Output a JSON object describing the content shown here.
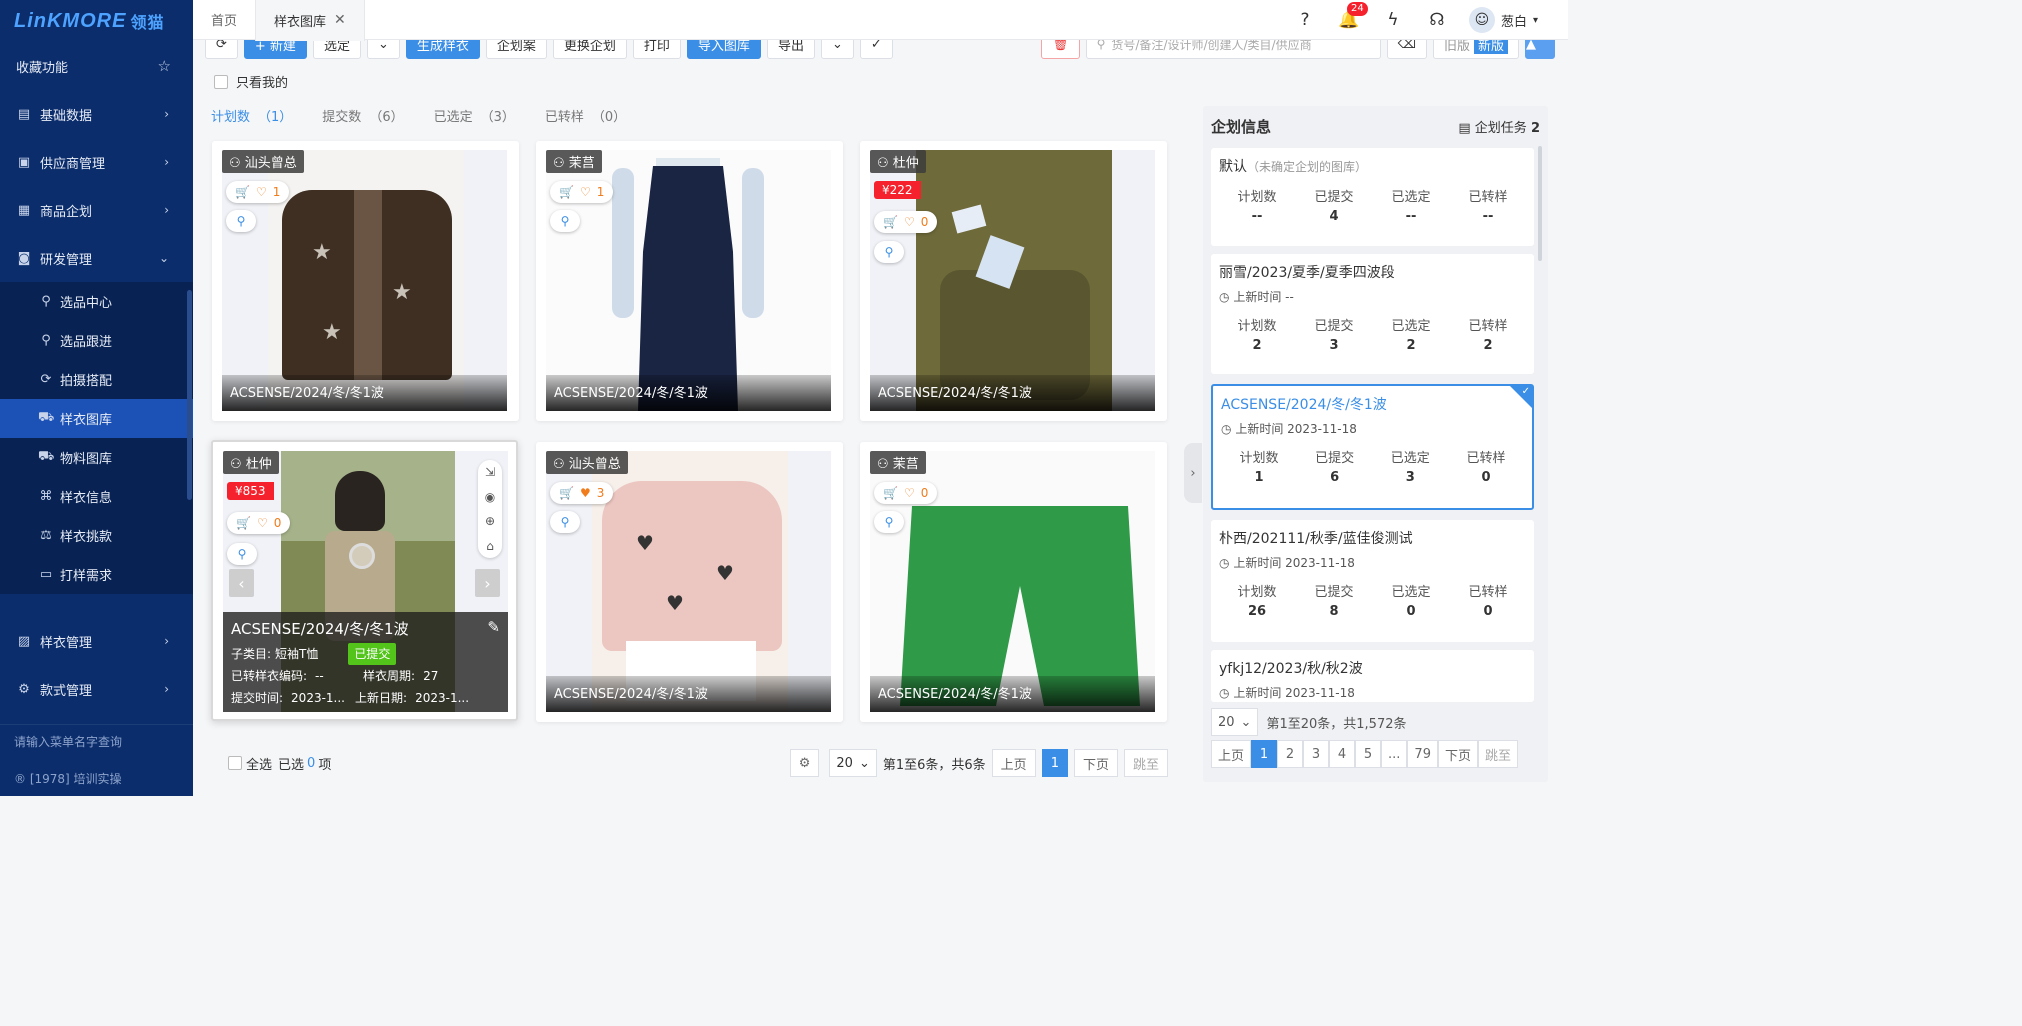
{
  "app": {
    "logo": "LinKMORE",
    "logo_cn": "领猫"
  },
  "sidebar": {
    "favorites": "收藏功能",
    "items": [
      {
        "label": "基础数据"
      },
      {
        "label": "供应商管理"
      },
      {
        "label": "商品企划"
      },
      {
        "label": "研发管理"
      }
    ],
    "sub_items": [
      {
        "label": "选品中心"
      },
      {
        "label": "选品跟进"
      },
      {
        "label": "拍摄搭配"
      },
      {
        "label": "样衣图库"
      },
      {
        "label": "物料图库"
      },
      {
        "label": "样衣信息"
      },
      {
        "label": "样衣挑款"
      },
      {
        "label": "打样需求"
      }
    ],
    "items2": [
      {
        "label": "样衣管理"
      },
      {
        "label": "款式管理"
      }
    ],
    "search_placeholder": "请输入菜单名字查询",
    "footer": "® [1978] 培训实操"
  },
  "tabs": [
    {
      "label": "首页"
    },
    {
      "label": "样衣图库"
    }
  ],
  "topbar": {
    "notif_count": "24",
    "user_name": "葱白"
  },
  "toolbar": {
    "new": "+ 新建",
    "select": "选定",
    "generate": "生成样衣",
    "plan": "企划案",
    "change_plan": "更换企划",
    "print": "打印",
    "import": "导入图库",
    "export": "导出",
    "search_placeholder": "货号/备注/设计师/创建人/类目/供应商",
    "old": "旧版",
    "new_ver": "新版"
  },
  "only_mine": "只看我的",
  "stat_tabs": [
    {
      "label": "计划数",
      "count": "（1）"
    },
    {
      "label": "提交数",
      "count": "（6）"
    },
    {
      "label": "已选定",
      "count": "（3）"
    },
    {
      "label": "已转样",
      "count": "（0）"
    }
  ],
  "cards": [
    {
      "owner": "汕头曾总",
      "fav": "1",
      "caption": "ACSENSE/2024/冬/冬1波"
    },
    {
      "owner": "茉莒",
      "fav": "1",
      "caption": "ACSENSE/2024/冬/冬1波"
    },
    {
      "owner": "杜仲",
      "price": "¥222",
      "fav": "0",
      "caption": "ACSENSE/2024/冬/冬1波"
    },
    {
      "owner": "杜仲",
      "price": "¥853",
      "fav": "0",
      "caption": "ACSENSE/2024/冬/冬1波",
      "subcat_label": "子类目:",
      "subcat": "短袖T恤",
      "status": "已提交",
      "code_label": "已转样衣编码:",
      "code": "--",
      "cycle_label": "样衣周期:",
      "cycle": "27",
      "submit_label": "提交时间:",
      "submit": "2023-1...",
      "newdate_label": "上新日期:",
      "newdate": "2023-1..."
    },
    {
      "owner": "汕头曾总",
      "fav": "3",
      "caption": "ACSENSE/2024/冬/冬1波"
    },
    {
      "owner": "茉莒",
      "fav": "0",
      "caption": "ACSENSE/2024/冬/冬1波"
    }
  ],
  "footer": {
    "select_all": "全选",
    "selected_prefix": "已选",
    "selected_count": "0",
    "selected_suffix": "项",
    "page_size": "20",
    "range": "第1至6条，共6条",
    "prev": "上页",
    "page": "1",
    "next": "下页",
    "jump": "跳至"
  },
  "panel": {
    "title": "企划信息",
    "task_label": "企划任务",
    "task_count": "2",
    "stat_labels": [
      "计划数",
      "已提交",
      "已选定",
      "已转样"
    ],
    "cards": [
      {
        "name": "默认",
        "sub": "（未确定企划的图库）",
        "values": [
          "--",
          "4",
          "--",
          "--"
        ]
      },
      {
        "name": "丽雪/2023/夏季/夏季四波段",
        "time": "上新时间 --",
        "values": [
          "2",
          "3",
          "2",
          "2"
        ]
      },
      {
        "name": "ACSENSE/2024/冬/冬1波",
        "time": "上新时间 2023-11-18",
        "values": [
          "1",
          "6",
          "3",
          "0"
        ]
      },
      {
        "name": "朴西/202111/秋季/蓝佳俊测试",
        "time": "上新时间 2023-11-18",
        "values": [
          "26",
          "8",
          "0",
          "0"
        ]
      },
      {
        "name": "yfkj12/2023/秋/秋2波",
        "time": "上新时间 2023-11-18"
      }
    ],
    "page_size": "20",
    "range": "第1至20条，共1,572条",
    "pager": [
      "上页",
      "1",
      "2",
      "3",
      "4",
      "5",
      "...",
      "79",
      "下页",
      "跳至"
    ]
  }
}
